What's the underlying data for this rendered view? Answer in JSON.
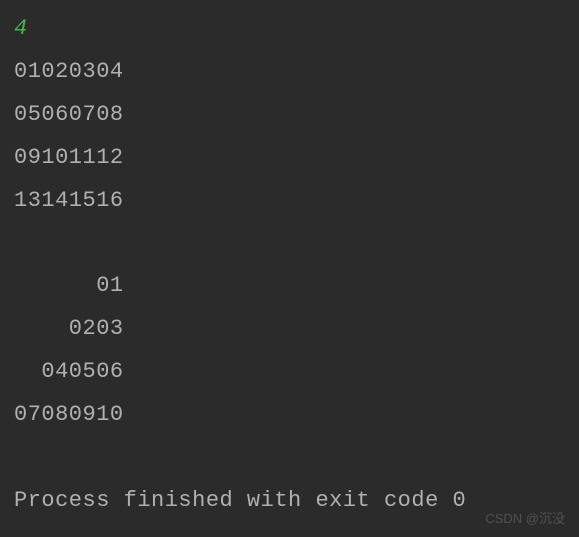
{
  "console": {
    "input": "4",
    "block1": [
      "01020304",
      "05060708",
      "09101112",
      "13141516"
    ],
    "block2": [
      "      01",
      "    0203",
      "  040506",
      "07080910"
    ],
    "exit_message": "Process finished with exit code 0"
  },
  "watermark": "CSDN @沉没"
}
